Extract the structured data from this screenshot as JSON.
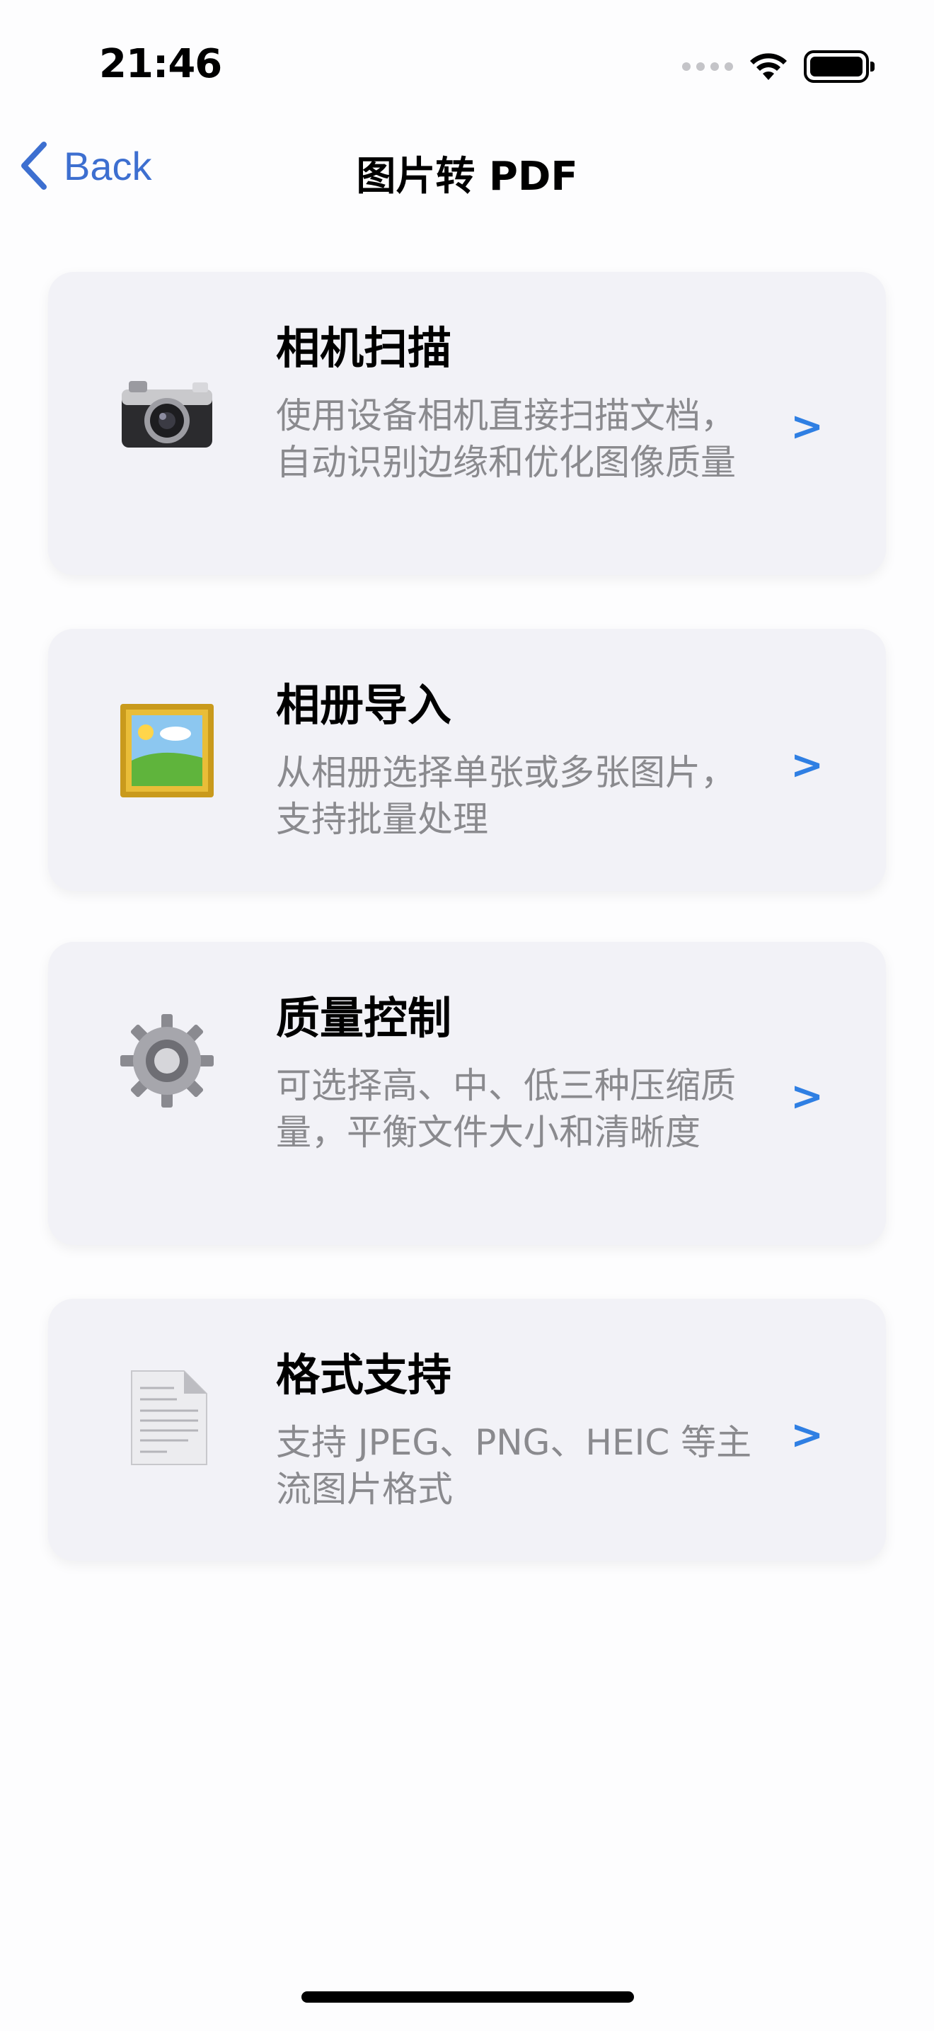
{
  "status_bar": {
    "time": "21:46"
  },
  "nav": {
    "back_label": "Back",
    "title": "图片转 PDF"
  },
  "features": [
    {
      "icon": "camera-icon",
      "title": "相机扫描",
      "description": "使用设备相机直接扫描文档，自动识别边缘和优化图像质量",
      "chevron": ">"
    },
    {
      "icon": "framed-picture-icon",
      "title": "相册导入",
      "description": "从相册选择单张或多张图片，支持批量处理",
      "chevron": ">"
    },
    {
      "icon": "gear-icon",
      "title": "质量控制",
      "description": "可选择高、中、低三种压缩质量，平衡文件大小和清晰度",
      "chevron": ">"
    },
    {
      "icon": "document-icon",
      "title": "格式支持",
      "description": "支持 JPEG、PNG、HEIC 等主流图片格式",
      "chevron": ">"
    }
  ],
  "colors": {
    "accent": "#3d6fd0",
    "chevron": "#2f7fe3",
    "card_bg": "#f2f2f7",
    "secondary_text": "#8a8a8e"
  }
}
